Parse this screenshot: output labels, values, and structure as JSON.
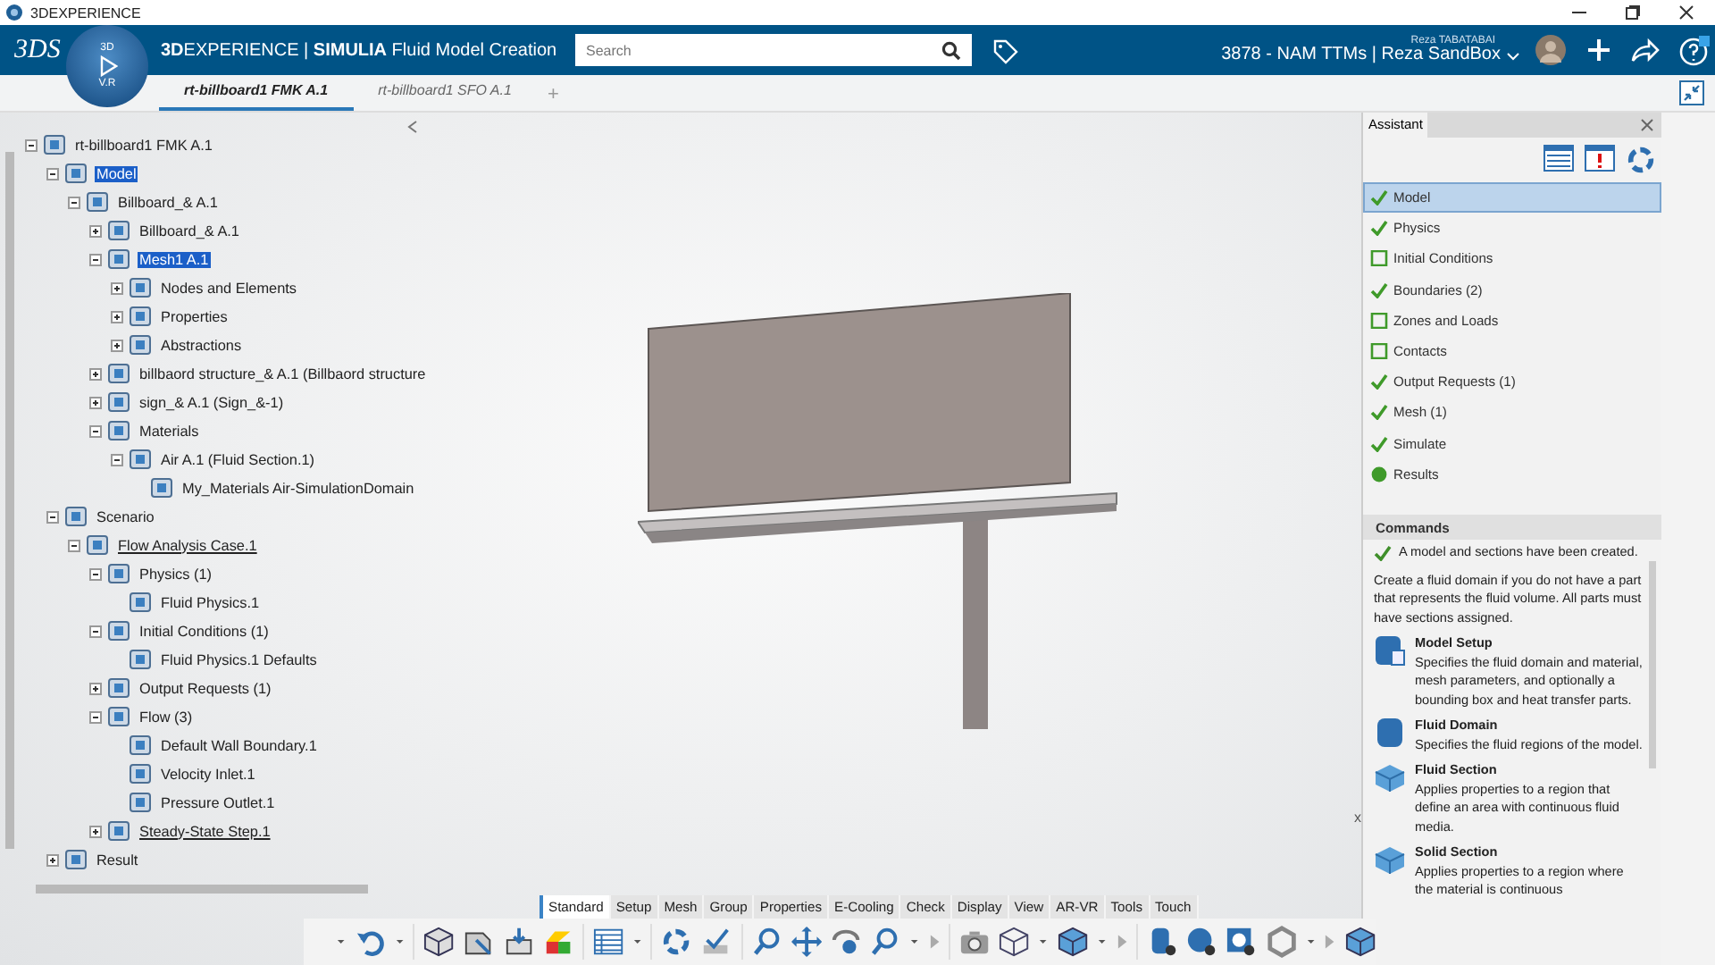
{
  "window": {
    "title": "3DEXPERIENCE"
  },
  "header": {
    "logo": "3DS",
    "compass_top": "3D",
    "compass_bottom": "V.R",
    "app_title": "**3D**EXPERIENCE | **SIMULIA** Fluid Model Creation",
    "search": {
      "placeholder": "Search"
    },
    "user_name": "Reza TABATABAI",
    "workspace": "3878 - NAM TTMs | Reza SandBox"
  },
  "tabs": [
    {
      "label": "rt-billboard1 FMK A.1",
      "selected": true
    },
    {
      "label": "rt-billboard1 SFO A.1",
      "selected": false
    }
  ],
  "add_tab": "+",
  "tree": {
    "label": "rt-billboard1 FMK A.1",
    "selected": false,
    "active": false,
    "expanded": true,
    "children": [
      {
        "label": "Model",
        "selected": true,
        "active": false,
        "expanded": true,
        "children": [
          {
            "label": "Billboard_& A.1",
            "selected": false,
            "active": false,
            "expanded": true,
            "children": [
              {
                "label": "Billboard_& A.1",
                "selected": false,
                "active": false,
                "expanded": false
              },
              {
                "label": "Mesh1 A.1",
                "selected": true,
                "active": false,
                "expanded": true,
                "children": [
                  {
                    "label": "Nodes and Elements",
                    "selected": false,
                    "active": false,
                    "expanded": false
                  },
                  {
                    "label": "Properties",
                    "selected": false,
                    "active": false,
                    "expanded": false
                  },
                  {
                    "label": "Abstractions",
                    "selected": false,
                    "active": false,
                    "expanded": false
                  }
                ]
              },
              {
                "label": "billbaord structure_& A.1 (Billbaord structure",
                "selected": false,
                "active": false,
                "expanded": false
              },
              {
                "label": "sign_& A.1 (Sign_&-1)",
                "selected": false,
                "active": false,
                "expanded": false
              },
              {
                "label": "Materials",
                "selected": false,
                "active": false,
                "expanded": true,
                "children": [
                  {
                    "label": "Air A.1 (Fluid Section.1)",
                    "selected": false,
                    "active": false,
                    "expanded": true,
                    "children": [
                      {
                        "label": "My_Materials Air-SimulationDomain",
                        "selected": false,
                        "active": false
                      }
                    ]
                  }
                ]
              }
            ]
          }
        ]
      },
      {
        "label": "Scenario",
        "selected": false,
        "active": false,
        "expanded": true,
        "children": [
          {
            "label": "Flow Analysis Case.1",
            "selected": false,
            "active": true,
            "expanded": true,
            "children": [
              {
                "label": "Physics (1)",
                "selected": false,
                "active": false,
                "expanded": true,
                "children": [
                  {
                    "label": "Fluid Physics.1",
                    "selected": false,
                    "active": false
                  }
                ]
              },
              {
                "label": "Initial Conditions (1)",
                "selected": false,
                "active": false,
                "expanded": true,
                "children": [
                  {
                    "label": "Fluid Physics.1 Defaults",
                    "selected": false,
                    "active": false
                  }
                ]
              },
              {
                "label": "Output Requests (1)",
                "selected": false,
                "active": false,
                "expanded": false
              },
              {
                "label": "Flow (3)",
                "selected": false,
                "active": false,
                "expanded": true,
                "children": [
                  {
                    "label": "Default Wall Boundary.1",
                    "selected": false,
                    "active": false
                  },
                  {
                    "label": "Velocity Inlet.1",
                    "selected": false,
                    "active": false
                  },
                  {
                    "label": "Pressure Outlet.1",
                    "selected": false,
                    "active": false
                  }
                ]
              },
              {
                "label": "Steady-State Step.1",
                "selected": false,
                "active": true,
                "expanded": false
              }
            ]
          }
        ]
      },
      {
        "label": "Result",
        "selected": false,
        "active": false,
        "expanded": false
      }
    ]
  },
  "viewport": {
    "axis_label": "x"
  },
  "assistant": {
    "title": "Assistant",
    "steps": [
      {
        "label": "Model",
        "kind": "check",
        "selected": true
      },
      {
        "label": "Physics",
        "kind": "check",
        "selected": false
      },
      {
        "label": "Initial Conditions",
        "kind": "box",
        "selected": false
      },
      {
        "label": "Boundaries (2)",
        "kind": "check",
        "selected": false
      },
      {
        "label": "Zones and Loads",
        "kind": "box",
        "selected": false
      },
      {
        "label": "Contacts",
        "kind": "box",
        "selected": false
      },
      {
        "label": "Output Requests (1)",
        "kind": "check",
        "selected": false
      },
      {
        "label": "Mesh (1)",
        "kind": "check",
        "selected": false
      },
      {
        "label": "Simulate",
        "kind": "check",
        "selected": false
      },
      {
        "label": "Results",
        "kind": "dot",
        "selected": false
      }
    ],
    "commands_title": "Commands",
    "note": "A model and sections have been created.",
    "intro": "Create a fluid domain if you do not have a part that represents the fluid volume. All parts must have sections assigned.",
    "commands": [
      {
        "title": "Model Setup",
        "description": "Specifies the fluid domain and material, mesh parameters, and optionally a bounding box and heat transfer parts.",
        "kind": "setup"
      },
      {
        "title": "Fluid Domain",
        "description": "Specifies the fluid regions of the model.",
        "kind": "domain"
      },
      {
        "title": "Fluid Section",
        "description": "Applies properties to a region that define an area with continuous fluid media.",
        "kind": "section"
      },
      {
        "title": "Solid Section",
        "description": "Applies properties to a region where the material is continuous",
        "kind": "section"
      }
    ]
  },
  "toolbar": {
    "tabs": [
      {
        "label": "Standard",
        "selected": true
      },
      {
        "label": "Setup",
        "selected": false
      },
      {
        "label": "Mesh",
        "selected": false
      },
      {
        "label": "Group",
        "selected": false
      },
      {
        "label": "Properties",
        "selected": false
      },
      {
        "label": "E-Cooling",
        "selected": false
      },
      {
        "label": "Check",
        "selected": false
      },
      {
        "label": "Display",
        "selected": false
      },
      {
        "label": "View",
        "selected": false
      },
      {
        "label": "AR-VR",
        "selected": false
      },
      {
        "label": "Tools",
        "selected": false
      },
      {
        "label": "Touch",
        "selected": false
      }
    ]
  }
}
